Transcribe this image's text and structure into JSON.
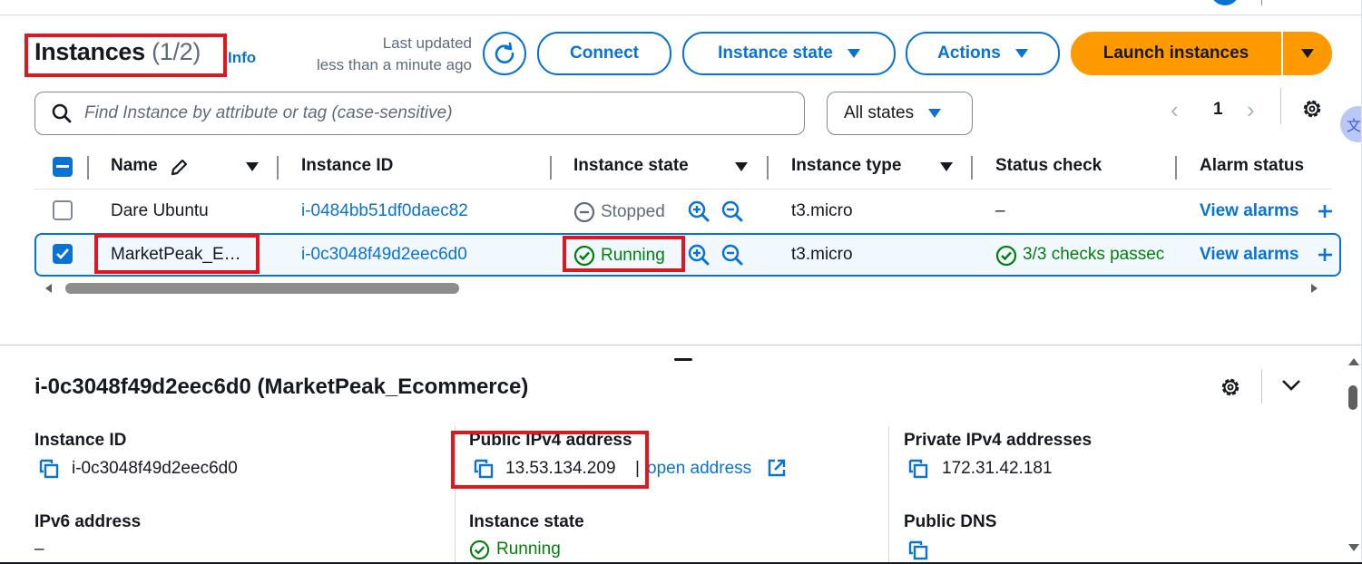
{
  "header": {
    "title": "Instances",
    "count": "(1/2)",
    "info": "Info",
    "last_updated_line1": "Last updated",
    "last_updated_line2": "less than a minute ago",
    "buttons": {
      "connect": "Connect",
      "instance_state": "Instance state",
      "actions": "Actions",
      "launch": "Launch instances"
    }
  },
  "filter": {
    "search_placeholder": "Find Instance by attribute or tag (case-sensitive)",
    "state_select": "All states"
  },
  "pagination": {
    "current_page": "1",
    "prev": "‹",
    "next": "›"
  },
  "table": {
    "columns": [
      "Name",
      "Instance ID",
      "Instance state",
      "Instance type",
      "Status check",
      "Alarm status"
    ],
    "rows": [
      {
        "name": "Dare Ubuntu",
        "instance_id": "i-0484bb51df0daec82",
        "state": "Stopped",
        "type": "t3.micro",
        "status_check": "–",
        "alarm": "View alarms",
        "selected": false
      },
      {
        "name": "MarketPeak_E…",
        "instance_id": "i-0c3048f49d2eec6d0",
        "state": "Running",
        "type": "t3.micro",
        "status_check": "3/3 checks passec",
        "alarm": "View alarms",
        "selected": true
      }
    ]
  },
  "details": {
    "title": "i-0c3048f49d2eec6d0 (MarketPeak_Ecommerce)",
    "instance_id_label": "Instance ID",
    "instance_id_value": "i-0c3048f49d2eec6d0",
    "public_ipv4_label": "Public IPv4 address",
    "public_ipv4_value": "13.53.134.209",
    "public_ipv4_sep": "|",
    "open_address": "open address",
    "private_ipv4_label": "Private IPv4 addresses",
    "private_ipv4_value": "172.31.42.181",
    "ipv6_label": "IPv6 address",
    "ipv6_value": "–",
    "instance_state_label": "Instance state",
    "instance_state_value": "Running",
    "public_dns_label": "Public DNS"
  },
  "colors": {
    "accent": "#0972d3",
    "launch_button": "#ff9900",
    "running_green": "#037f0c",
    "highlight_red": "#e0171f"
  },
  "icons": [
    "refresh-icon",
    "search-icon",
    "gear-icon",
    "pencil-icon",
    "zoom-in-icon",
    "zoom-out-icon",
    "stopped-icon",
    "check-circle-icon",
    "copy-icon",
    "external-link-icon",
    "plus-icon",
    "chevron-down-icon",
    "translate-icon"
  ]
}
